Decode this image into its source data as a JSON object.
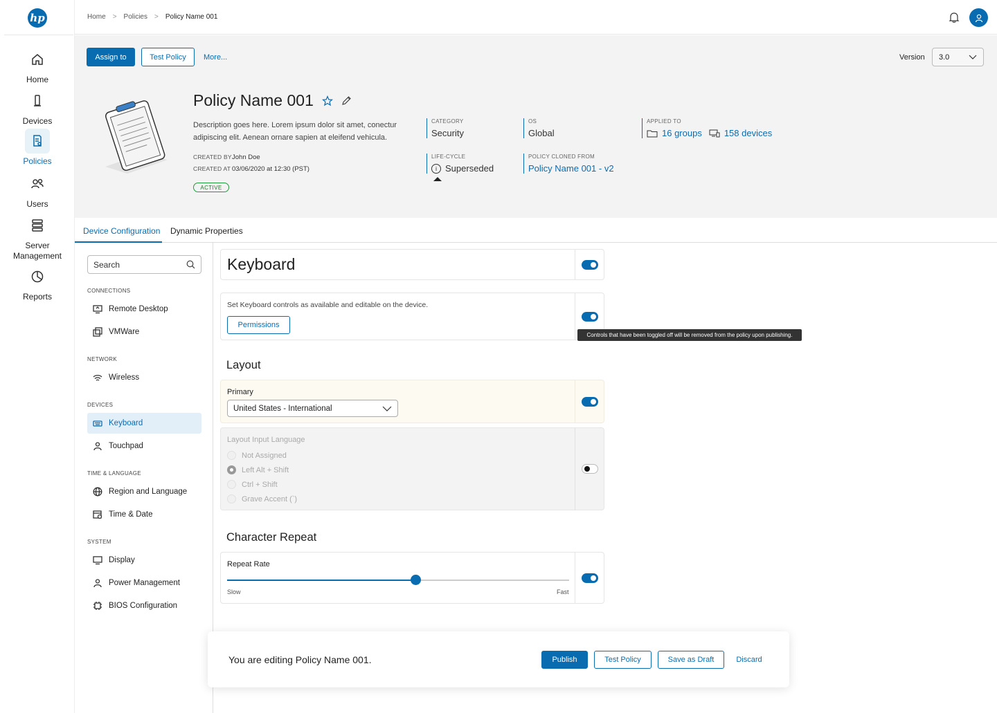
{
  "nav": {
    "logo": "hp",
    "items": [
      {
        "label": "Home",
        "icon": "home-icon"
      },
      {
        "label": "Devices",
        "icon": "device-icon"
      },
      {
        "label": "Policies",
        "icon": "policy-icon"
      },
      {
        "label": "Users",
        "icon": "users-icon"
      },
      {
        "label": "Server Management",
        "icon": "server-icon"
      },
      {
        "label": "Reports",
        "icon": "reports-icon"
      }
    ],
    "active": "Policies"
  },
  "breadcrumb": [
    "Home",
    "Policies",
    "Policy Name 001"
  ],
  "actions": {
    "assign": "Assign to",
    "test": "Test Policy",
    "more": "More..."
  },
  "version": {
    "label": "Version",
    "value": "3.0"
  },
  "policy": {
    "title": "Policy Name 001",
    "description": "Description goes here. Lorem ipsum dolor sit amet, conectur adipiscing elit. Aenean ornare sapien at eleifend vehicula.",
    "created_by_label": "CREATED BY",
    "created_by": "John Doe",
    "created_at_label": "CREATED AT",
    "created_at": "03/06/2020 at 12:30 (PST)",
    "status": "ACTIVE",
    "category_label": "CATEGORY",
    "category": "Security",
    "os_label": "OS",
    "os": "Global",
    "applied_label": "APPLIED TO",
    "applied_groups": "16 groups",
    "applied_devices": "158 devices",
    "lifecycle_label": "LIFE-CYCLE",
    "lifecycle": "Superseded",
    "cloned_label": "POLICY CLONED FROM",
    "cloned": "Policy Name 001 - v2"
  },
  "tabs": [
    "Device Configuration",
    "Dynamic Properties"
  ],
  "sidebar": {
    "search_placeholder": "Search",
    "sections": {
      "connections": "CONNECTIONS",
      "network": "NETWORK",
      "devices": "DEVICES",
      "time_language": "TIME & LANGUAGE",
      "system": "SYSTEM"
    },
    "items": {
      "remote_desktop": "Remote Desktop",
      "vmware": "VMWare",
      "wireless": "Wireless",
      "keyboard": "Keyboard",
      "touchpad": "Touchpad",
      "region": "Region and Language",
      "time_date": "Time & Date",
      "display": "Display",
      "power": "Power Management",
      "bios": "BIOS Configuration"
    }
  },
  "content": {
    "keyboard_title": "Keyboard",
    "keyboard_desc": "Set Keyboard controls as available and editable on the device.",
    "permissions": "Permissions",
    "tooltip": "Controls that have been toggled off will be removed from the policy upon publishing.",
    "layout_title": "Layout",
    "primary_label": "Primary",
    "primary_value": "United States - International",
    "input_lang_label": "Layout Input Language",
    "input_lang_options": [
      "Not Assigned",
      "Left Alt + Shift",
      "Ctrl + Shift",
      "Grave Accent (`)"
    ],
    "input_lang_selected": "Left Alt + Shift",
    "char_repeat_title": "Character Repeat",
    "repeat_rate_label": "Repeat Rate",
    "repeat_rate_value": 0.55,
    "slow": "Slow",
    "fast": "Fast",
    "toggles": {
      "keyboard": true,
      "keyboard_controls": true,
      "primary": true,
      "input_language": false,
      "repeat_rate": true
    }
  },
  "footer": {
    "message": "You are editing Policy Name 001.",
    "publish": "Publish",
    "test": "Test Policy",
    "draft": "Save as Draft",
    "discard": "Discard"
  },
  "colors": {
    "accent": "#0a6cb0",
    "active_green": "#1e9b3a",
    "tooltip_bg": "#333333"
  }
}
